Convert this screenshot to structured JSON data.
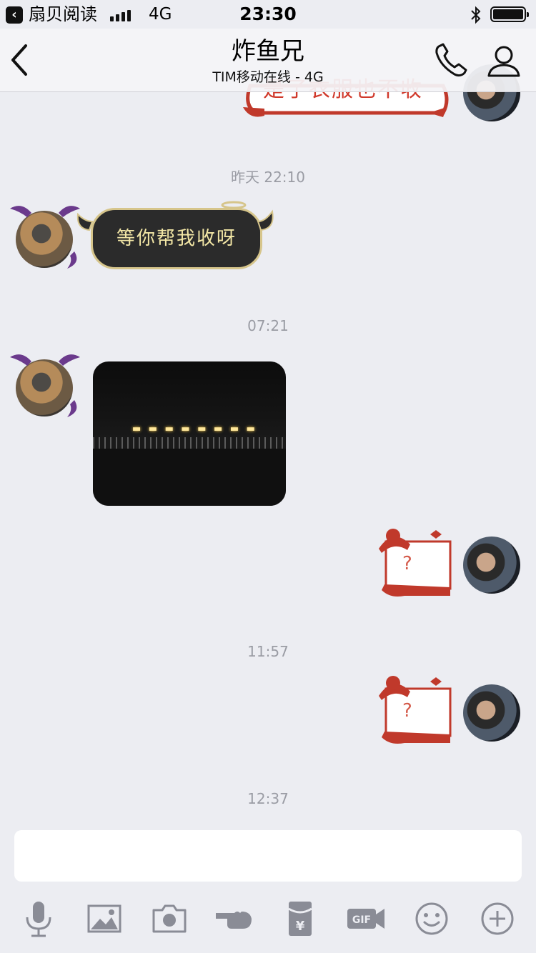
{
  "status_bar": {
    "back_app": "扇贝阅读",
    "network": "4G",
    "time": "23:30"
  },
  "nav": {
    "title": "炸鱼兄",
    "subtitle": "TIM移动在线 - 4G"
  },
  "messages": {
    "partial_top_text": "是了衣服也不收",
    "ts1": "昨天 22:10",
    "bubble1_text": "等你帮我收呀",
    "ts2": "07:21",
    "xmas_q": "?",
    "ts3": "11:57",
    "ts4": "12:37"
  },
  "input": {
    "placeholder": ""
  },
  "toolbar": {
    "items": [
      "microphone-icon",
      "image-icon",
      "camera-icon",
      "poke-icon",
      "red-packet-icon",
      "gif-icon",
      "emoji-icon",
      "plus-icon"
    ]
  },
  "colors": {
    "background": "#ecedf2",
    "bubble_dark": "#2b2b2b",
    "bubble_text": "#f3e7a6",
    "accent_red": "#d0392b",
    "icon_gray": "#8a8c96"
  }
}
